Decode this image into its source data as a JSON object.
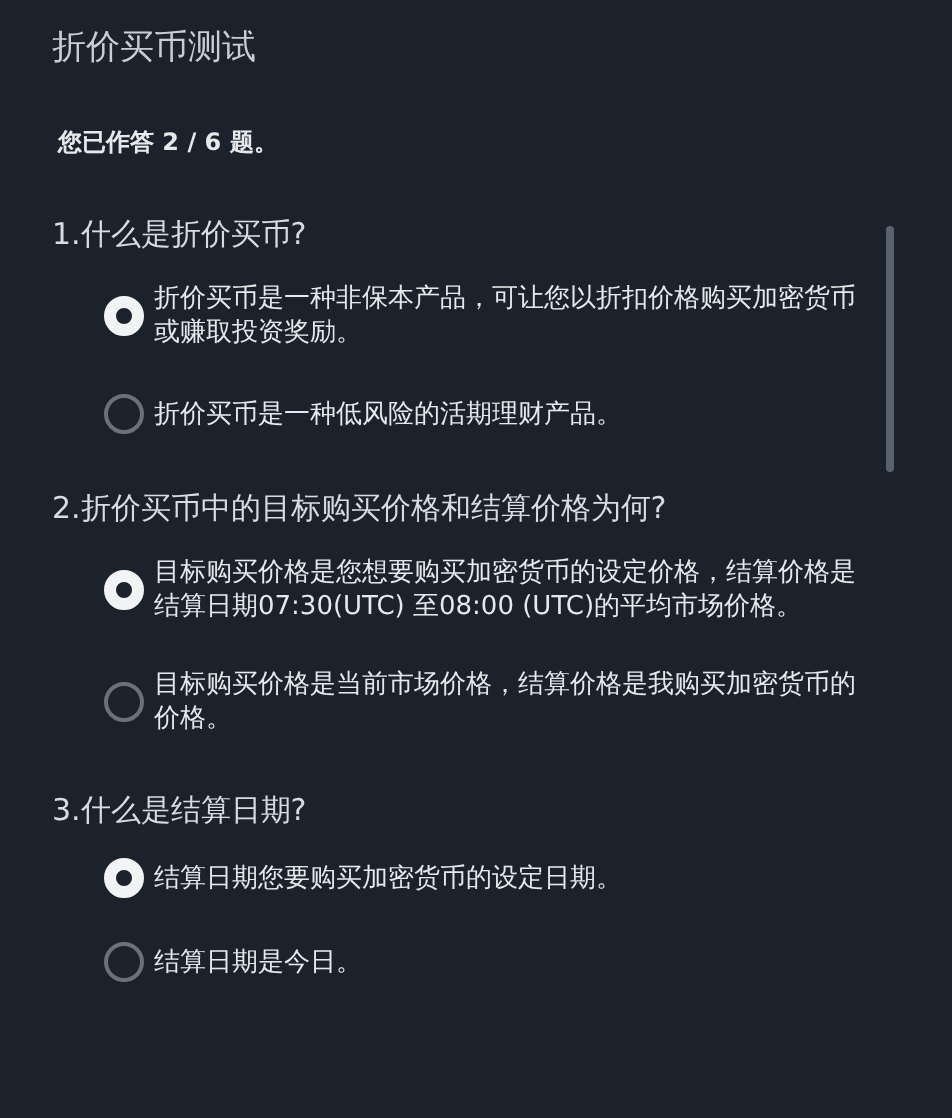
{
  "title": "折价买币测试",
  "progress": "您已作答 2 / 6 题。",
  "questions": [
    {
      "text": "1.什么是折价买币?",
      "options": [
        {
          "text": "折价买币是一种非保本产品，可让您以折扣价格购买加密货币或赚取投资奖励。",
          "selected": true
        },
        {
          "text": "折价买币是一种低风险的活期理财产品。",
          "selected": false
        }
      ]
    },
    {
      "text": "2.折价买币中的目标购买价格和结算价格为何?",
      "options": [
        {
          "text": "目标购买价格是您想要购买加密货币的设定价格，结算价格是结算日期07:30(UTC) 至08:00 (UTC)的平均市场价格。",
          "selected": true
        },
        {
          "text": "目标购买价格是当前市场价格，结算价格是我购买加密货币的价格。",
          "selected": false
        }
      ]
    },
    {
      "text": "3.什么是结算日期?",
      "options": [
        {
          "text": "结算日期您要购买加密货币的设定日期。",
          "selected": true
        },
        {
          "text": "结算日期是今日。",
          "selected": false
        }
      ]
    }
  ]
}
